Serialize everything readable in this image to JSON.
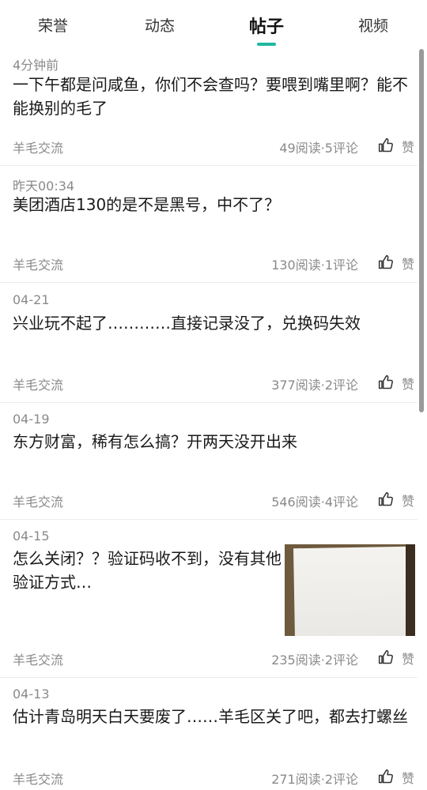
{
  "tabs": [
    {
      "label": "荣誉",
      "active": false
    },
    {
      "label": "动态",
      "active": false
    },
    {
      "label": "帖子",
      "active": true
    },
    {
      "label": "视频",
      "active": false
    }
  ],
  "accent_color": "#1fb8a0",
  "like_icon": "thumbs-up-icon",
  "posts": [
    {
      "date": "4分钟前",
      "title": "一下午都是问咸鱼，你们不会查吗？要喂到嘴里啊？能不能换别的毛了",
      "category": "羊毛交流",
      "stats": "49阅读·5评论",
      "like_label": "赞"
    },
    {
      "date": "昨天00:34",
      "title": "美团酒店130的是不是黑号，中不了？",
      "category": "羊毛交流",
      "stats": "130阅读·1评论",
      "like_label": "赞"
    },
    {
      "date": "04-21",
      "title": "兴业玩不起了…………直接记录没了，兑换码失效",
      "category": "羊毛交流",
      "stats": "377阅读·2评论",
      "like_label": "赞"
    },
    {
      "date": "04-19",
      "title": "东方财富，稀有怎么搞？开两天没开出来",
      "category": "羊毛交流",
      "stats": "546阅读·4评论",
      "like_label": "赞"
    },
    {
      "date": "04-15",
      "title": "怎么关闭？？验证码收不到，没有其他验证方式…",
      "category": "羊毛交流",
      "stats": "235阅读·2评论",
      "like_label": "赞",
      "has_image": true
    },
    {
      "date": "04-13",
      "title": "估计青岛明天白天要废了……羊毛区关了吧，都去打螺丝",
      "category": "羊毛交流",
      "stats": "271阅读·2评论",
      "like_label": "赞"
    }
  ]
}
